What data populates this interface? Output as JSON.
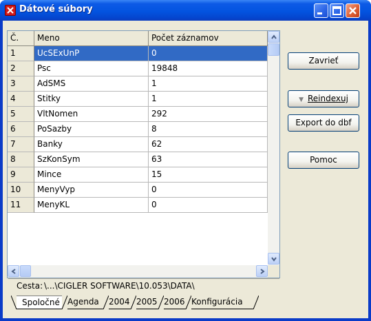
{
  "window": {
    "title": "Dátové súbory"
  },
  "grid": {
    "columns": [
      "Č.",
      "Meno",
      "Počet záznamov"
    ],
    "rows": [
      {
        "no": "1",
        "name": "UcSExUnP",
        "count": "0",
        "selected": true
      },
      {
        "no": "2",
        "name": "Psc",
        "count": "19848"
      },
      {
        "no": "3",
        "name": "AdSMS",
        "count": "1"
      },
      {
        "no": "4",
        "name": "Stitky",
        "count": "1"
      },
      {
        "no": "5",
        "name": "VltNomen",
        "count": "292"
      },
      {
        "no": "6",
        "name": "PoSazby",
        "count": "8"
      },
      {
        "no": "7",
        "name": "Banky",
        "count": "62"
      },
      {
        "no": "8",
        "name": "SzKonSym",
        "count": "63"
      },
      {
        "no": "9",
        "name": "Mince",
        "count": "15"
      },
      {
        "no": "10",
        "name": "MenyVyp",
        "count": "0"
      },
      {
        "no": "11",
        "name": "MenyKL",
        "count": "0"
      }
    ]
  },
  "buttons": {
    "close": "Zavrieť",
    "reindex": "Reindexuj",
    "export": "Export do dbf",
    "help": "Pomoc"
  },
  "path": {
    "label": "Cesta:",
    "value": "\\...\\CIGLER SOFTWARE\\10.053\\DATA\\"
  },
  "tabs": [
    "Spoločné",
    "Agenda",
    "2004",
    "2005",
    "2006",
    "Konfigurácia"
  ],
  "colors": {
    "titlebar": "#0354e0",
    "selection": "#316ac5",
    "face": "#ece9d8"
  }
}
